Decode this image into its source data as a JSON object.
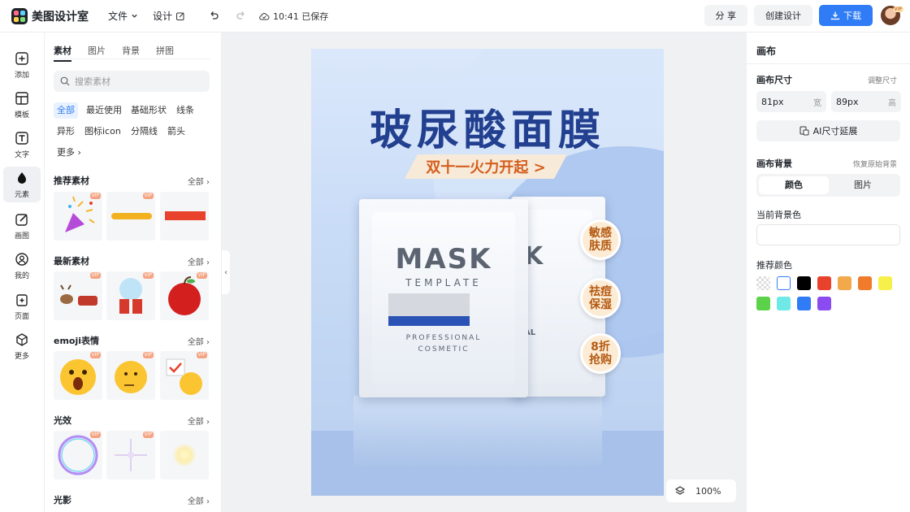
{
  "app": {
    "name": "美图设计室",
    "saved_status": "10:41 已保存"
  },
  "menu": {
    "file": "文件",
    "design": "设计"
  },
  "top_actions": {
    "share": "分 享",
    "create": "创建设计",
    "download": "下载",
    "vip_label": "VIP"
  },
  "rail": [
    {
      "label": "添加",
      "icon": "plus-square-icon"
    },
    {
      "label": "模板",
      "icon": "template-icon"
    },
    {
      "label": "文字",
      "icon": "text-icon"
    },
    {
      "label": "元素",
      "icon": "elements-icon"
    },
    {
      "label": "画图",
      "icon": "draw-icon"
    },
    {
      "label": "我的",
      "icon": "user-icon"
    },
    {
      "label": "页面",
      "icon": "page-icon"
    },
    {
      "label": "更多",
      "icon": "cube-icon"
    }
  ],
  "panel": {
    "tabs": [
      "素材",
      "图片",
      "背景",
      "拼图"
    ],
    "search_placeholder": "搜索素材",
    "chips": [
      "全部",
      "最近使用",
      "基础形状",
      "线条",
      "异形",
      "图标icon",
      "分隔线",
      "箭头",
      "更多"
    ],
    "sections": [
      {
        "title": "推荐素材",
        "all": "全部"
      },
      {
        "title": "最新素材",
        "all": "全部"
      },
      {
        "title": "emoji表情",
        "all": "全部"
      },
      {
        "title": "光效",
        "all": "全部"
      },
      {
        "title": "光影",
        "all": "全部"
      }
    ],
    "vip": "VIP"
  },
  "poster": {
    "title": "玻尿酸面膜",
    "banner": "双十一火力开起 >",
    "mask_word": "MASK",
    "template_word": "TEMPLATE",
    "professional": "PROFESSIONAL",
    "cosmetic": "COSMETIC",
    "back_letter": "K",
    "back_suffix": "AL",
    "badges": [
      {
        "line1": "敏感",
        "line2": "肤质"
      },
      {
        "line1": "祛痘",
        "line2": "保湿"
      },
      {
        "line1": "8折",
        "line2": "抢购"
      }
    ]
  },
  "zoom": {
    "value": "100%"
  },
  "props": {
    "title": "画布",
    "size_label": "画布尺寸",
    "size_link": "调整尺寸",
    "width_value": "81px",
    "width_unit": "宽",
    "height_value": "89px",
    "height_unit": "高",
    "ai_button": "AI尺寸延展",
    "bg_label": "画布背景",
    "bg_link": "恢复原始背景",
    "seg_color": "颜色",
    "seg_image": "图片",
    "current_bg_label": "当前背景色",
    "recommend_label": "推荐颜色",
    "swatches": [
      "transparent",
      "#ffffff",
      "#000000",
      "#e8412c",
      "#f2a94c",
      "#ef7b2b",
      "#f7f04a",
      "#5cd24a",
      "#6fe8e8",
      "#2f7cf6",
      "#8a4cf0"
    ]
  }
}
